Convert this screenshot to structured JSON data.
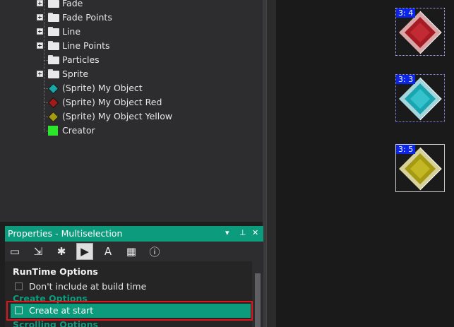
{
  "tree": {
    "items": [
      {
        "label": "Fade",
        "icon": "folder-icon",
        "expandable": true
      },
      {
        "label": "Fade Points",
        "icon": "folder-icon",
        "expandable": true
      },
      {
        "label": "Line",
        "icon": "folder-icon",
        "expandable": true
      },
      {
        "label": "Line Points",
        "icon": "folder-icon",
        "expandable": true
      },
      {
        "label": "Particles",
        "icon": "folder-icon",
        "expandable": false
      },
      {
        "label": "Sprite",
        "icon": "folder-icon",
        "expandable": true
      },
      {
        "label": "(Sprite) My Object",
        "icon": "teal-diamond-icon",
        "color": "#1aa6a6"
      },
      {
        "label": "(Sprite) My Object Red",
        "icon": "red-diamond-icon",
        "color": "#a11b1b"
      },
      {
        "label": "(Sprite) My Object Yellow",
        "icon": "yellow-diamond-icon",
        "color": "#a69a10"
      },
      {
        "label": "Creator",
        "icon": "green-square-icon",
        "color": "#2be62b"
      }
    ]
  },
  "frame": {
    "objects": [
      {
        "tag": "3: 4",
        "name": "red-gem",
        "color": "#a61b24"
      },
      {
        "tag": "3: 3",
        "name": "teal-gem",
        "color": "#1aa6b0"
      },
      {
        "tag": "3: 5",
        "name": "yellow-gem",
        "color": "#a69a12"
      }
    ]
  },
  "properties": {
    "title": "Properties - Multiselection",
    "title_buttons": {
      "dropdown": "▾",
      "pin": "⊥",
      "close": "✕"
    },
    "tabs": [
      {
        "name": "tab-display",
        "glyph": "▭"
      },
      {
        "name": "tab-size-position",
        "glyph": "⇲"
      },
      {
        "name": "tab-movement",
        "glyph": "✱"
      },
      {
        "name": "tab-runtime-options",
        "glyph": "▶",
        "active": true
      },
      {
        "name": "tab-values",
        "glyph": "A"
      },
      {
        "name": "tab-events",
        "glyph": "▦"
      },
      {
        "name": "tab-about",
        "glyph": "ⓘ"
      }
    ],
    "sections": {
      "runtime": "RunTime Options",
      "create": "Create Options",
      "scrolling": "Scrolling Options"
    },
    "rows": {
      "dont_include": "Don't include at build time",
      "create_at_start": "Create at start"
    }
  },
  "colors": {
    "accent": "#0c9b7c",
    "highlight_border": "#e0141a",
    "tag_bg": "#0a24e8"
  }
}
